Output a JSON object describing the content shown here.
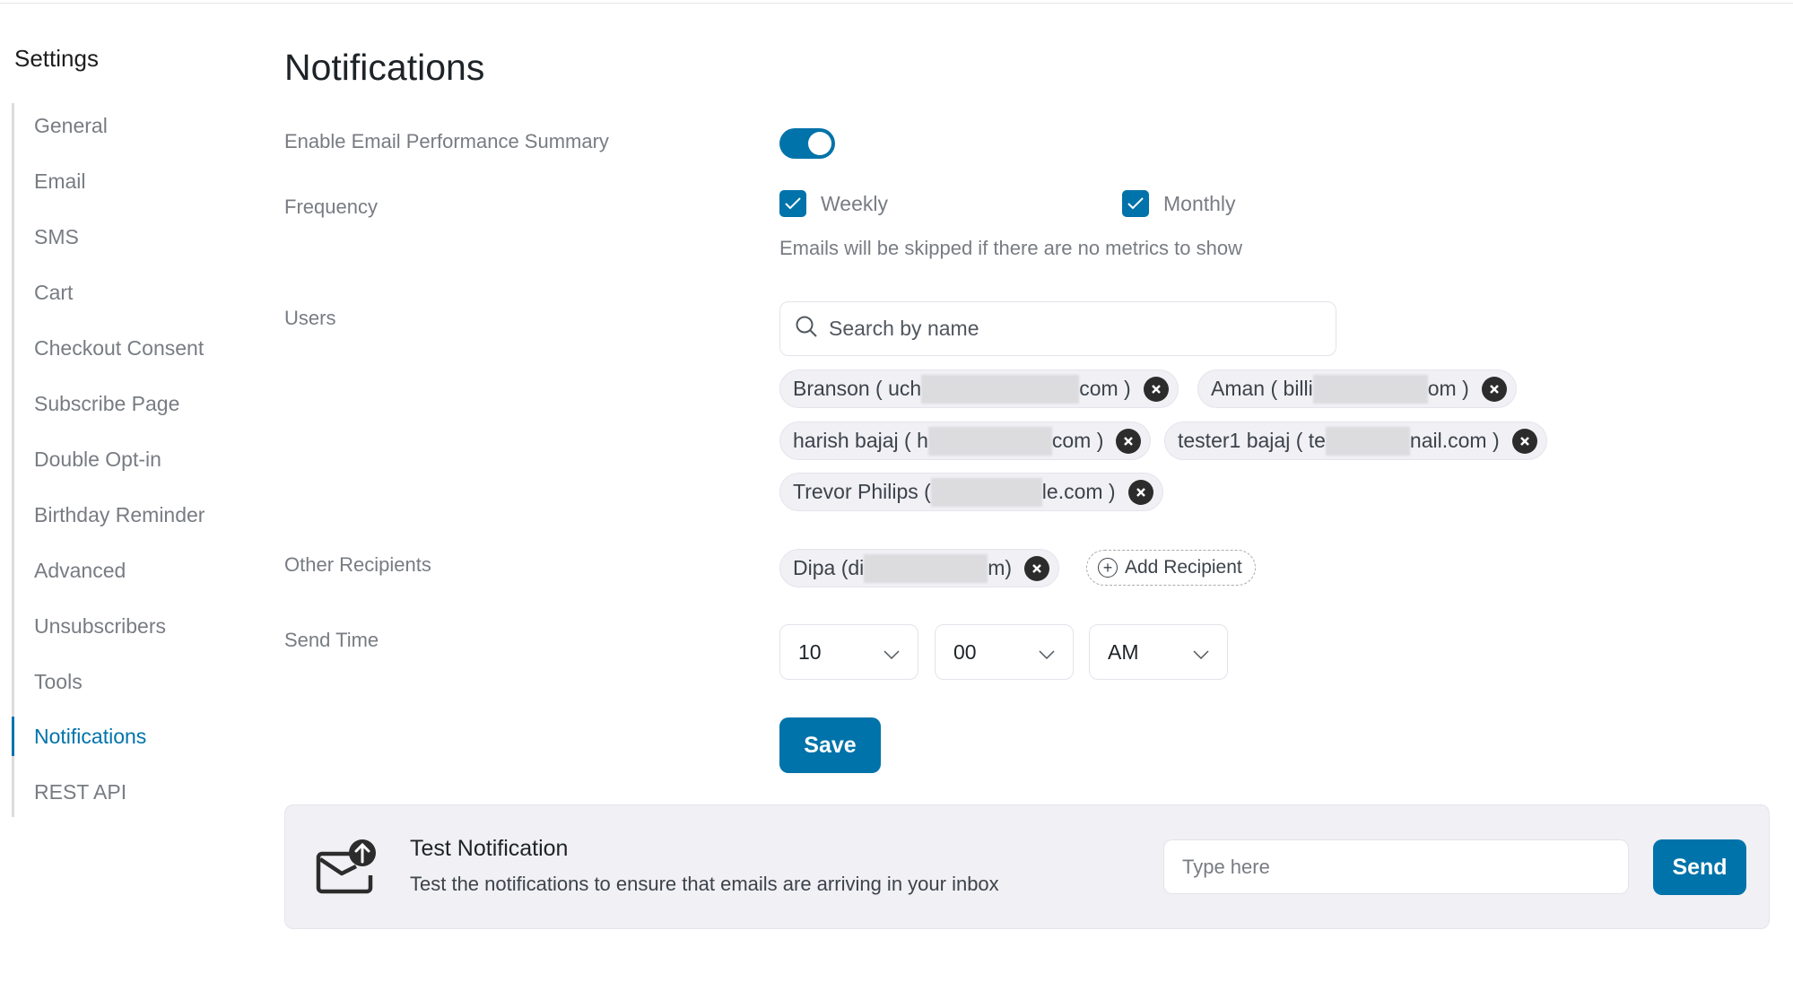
{
  "sidebar": {
    "title": "Settings",
    "items": [
      {
        "label": "General"
      },
      {
        "label": "Email"
      },
      {
        "label": "SMS"
      },
      {
        "label": "Cart"
      },
      {
        "label": "Checkout Consent"
      },
      {
        "label": "Subscribe Page"
      },
      {
        "label": "Double Opt-in"
      },
      {
        "label": "Birthday Reminder"
      },
      {
        "label": "Advanced"
      },
      {
        "label": "Unsubscribers"
      },
      {
        "label": "Tools"
      },
      {
        "label": "Notifications",
        "active": true
      },
      {
        "label": "REST API"
      }
    ]
  },
  "main": {
    "title": "Notifications",
    "enable_summary": {
      "label": "Enable Email Performance Summary",
      "enabled": true
    },
    "frequency": {
      "label": "Frequency",
      "options": [
        {
          "label": "Weekly",
          "checked": true
        },
        {
          "label": "Monthly",
          "checked": true
        }
      ],
      "hint": "Emails will be skipped if there are no metrics to show"
    },
    "users": {
      "label": "Users",
      "search_placeholder": "Search by name",
      "chips": [
        {
          "pre": "Branson ( uch",
          "post": "com )"
        },
        {
          "pre": "Aman ( billi",
          "post": "om )"
        },
        {
          "pre": "harish bajaj ( h",
          "post": "com )"
        },
        {
          "pre": "tester1 bajaj ( te",
          "post": "nail.com )"
        },
        {
          "pre": "Trevor Philips ( ",
          "post": "le.com )"
        }
      ]
    },
    "other_recipients": {
      "label": "Other Recipients",
      "chips": [
        {
          "pre": "Dipa (di",
          "post": "m)"
        }
      ],
      "add_label": "Add Recipient"
    },
    "send_time": {
      "label": "Send Time",
      "hour": "10",
      "minute": "00",
      "period": "AM"
    },
    "save_label": "Save"
  },
  "test_notification": {
    "title": "Test Notification",
    "description": "Test the notifications to ensure that emails are arriving in your inbox",
    "input_placeholder": "Type here",
    "send_label": "Send"
  },
  "colors": {
    "accent": "#0073aa",
    "chip_bg": "#f0f0f5",
    "muted_text": "#787c82"
  }
}
